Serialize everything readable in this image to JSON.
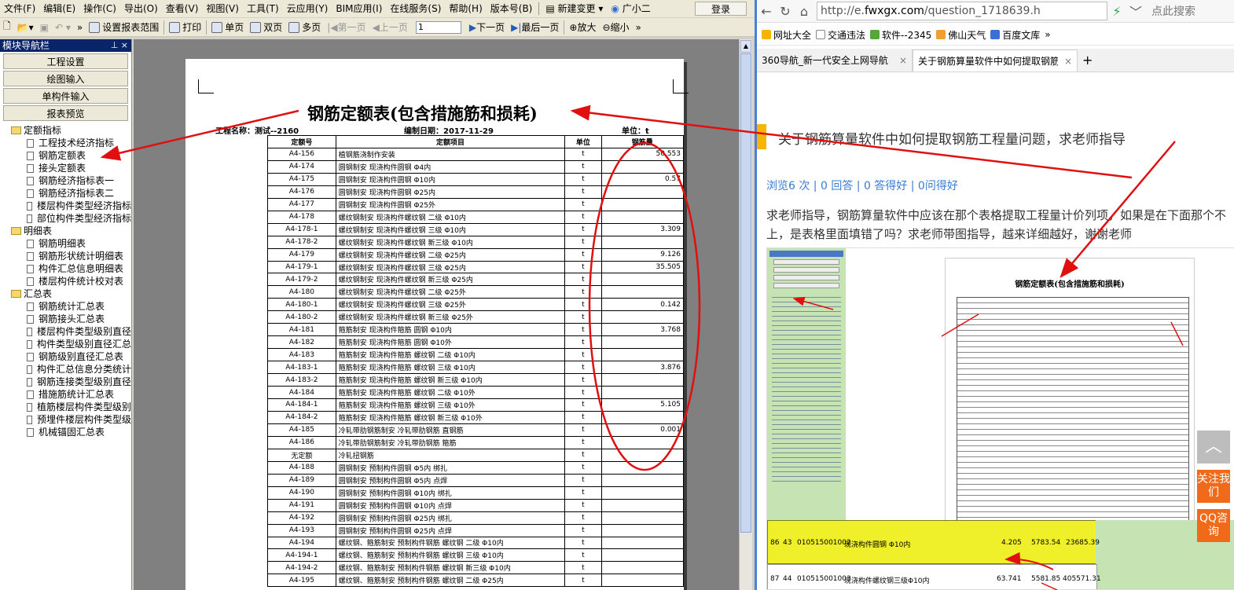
{
  "menubar": {
    "items": [
      "文件(F)",
      "编辑(E)",
      "操作(C)",
      "导出(O)",
      "查看(V)",
      "视图(V)",
      "工具(T)",
      "云应用(Y)",
      "BIM应用(I)",
      "在线服务(S)",
      "帮助(H)",
      "版本号(B)"
    ],
    "new_change": "新建变更",
    "helper": "广小二",
    "login": "登录"
  },
  "toolbar": {
    "set_range": "设置报表范围",
    "print": "打印",
    "single": "单页",
    "double": "双页",
    "multi": "多页",
    "first": "第一页",
    "prev": "上一页",
    "page": "1",
    "next": "下一页",
    "last": "最后一页",
    "zoom_in": "放大",
    "zoom_out": "缩小"
  },
  "nav": {
    "title": "模块导航栏",
    "buttons": [
      "工程设置",
      "绘图输入",
      "单构件输入",
      "报表预览"
    ],
    "tree": [
      {
        "folder": "定额指标",
        "items": [
          "工程技术经济指标",
          "钢筋定额表",
          "接头定额表",
          "钢筋经济指标表一",
          "钢筋经济指标表二",
          "楼层构件类型经济指标",
          "部位构件类型经济指标"
        ]
      },
      {
        "folder": "明细表",
        "items": [
          "钢筋明细表",
          "钢筋形状统计明细表",
          "构件汇总信息明细表",
          "楼层构件统计校对表"
        ]
      },
      {
        "folder": "汇总表",
        "items": [
          "钢筋统计汇总表",
          "钢筋接头汇总表",
          "楼层构件类型级别直径",
          "构件类型级别直径汇总",
          "钢筋级别直径汇总表",
          "构件汇总信息分类统计",
          "钢筋连接类型级别直径",
          "措施筋统计汇总表",
          "植筋楼层构件类型级别",
          "预埋件楼层构件类型级",
          "机械锚固汇总表"
        ]
      }
    ]
  },
  "report": {
    "title": "钢筋定额表(包含措施筋和损耗)",
    "project_label": "工程名称：",
    "project": "测试--2160",
    "date_label": "编制日期：",
    "date": "2017-11-29",
    "unit_label": "单位：",
    "unit": "t",
    "headers": [
      "定额号",
      "定额项目",
      "单位",
      "钢筋量"
    ],
    "rows": [
      [
        "A4-156",
        "植钢筋浇制作安装",
        "t",
        "50.553"
      ],
      [
        "A4-174",
        "圆钢制安 现浇构件圆钢 Φ4内",
        "t",
        ""
      ],
      [
        "A4-175",
        "圆钢制安 现浇构件圆钢 Φ10内",
        "t",
        "0.57"
      ],
      [
        "A4-176",
        "圆钢制安 现浇构件圆钢 Φ25内",
        "t",
        ""
      ],
      [
        "A4-177",
        "圆钢制安 现浇构件圆钢 Φ25外",
        "t",
        ""
      ],
      [
        "A4-178",
        "螺纹钢制安 现浇构件螺纹钢 二级 Φ10内",
        "t",
        ""
      ],
      [
        "A4-178-1",
        "螺纹钢制安 现浇构件螺纹钢 三级 Φ10内",
        "t",
        "3.309"
      ],
      [
        "A4-178-2",
        "螺纹钢制安 现浇构件螺纹钢 新三级 Φ10内",
        "t",
        ""
      ],
      [
        "A4-179",
        "螺纹钢制安 现浇构件螺纹钢 二级 Φ25内",
        "t",
        "9.126"
      ],
      [
        "A4-179-1",
        "螺纹钢制安 现浇构件螺纹钢 三级 Φ25内",
        "t",
        "35.505"
      ],
      [
        "A4-179-2",
        "螺纹钢制安 现浇构件螺纹钢 新三级 Φ25内",
        "t",
        ""
      ],
      [
        "A4-180",
        "螺纹钢制安 现浇构件螺纹钢 二级 Φ25外",
        "t",
        ""
      ],
      [
        "A4-180-1",
        "螺纹钢制安 现浇构件螺纹钢 三级 Φ25外",
        "t",
        "0.142"
      ],
      [
        "A4-180-2",
        "螺纹钢制安 现浇构件螺纹钢 新三级 Φ25外",
        "t",
        ""
      ],
      [
        "A4-181",
        "箍筋制安 现浇构件箍筋 圆钢 Φ10内",
        "t",
        "3.768"
      ],
      [
        "A4-182",
        "箍筋制安 现浇构件箍筋 圆钢 Φ10外",
        "t",
        ""
      ],
      [
        "A4-183",
        "箍筋制安 现浇构件箍筋 螺纹钢 二级 Φ10内",
        "t",
        ""
      ],
      [
        "A4-183-1",
        "箍筋制安 现浇构件箍筋 螺纹钢 三级 Φ10内",
        "t",
        "3.876"
      ],
      [
        "A4-183-2",
        "箍筋制安 现浇构件箍筋 螺纹钢 新三级 Φ10内",
        "t",
        ""
      ],
      [
        "A4-184",
        "箍筋制安 现浇构件箍筋 螺纹钢 二级 Φ10外",
        "t",
        ""
      ],
      [
        "A4-184-1",
        "箍筋制安 现浇构件箍筋 螺纹钢 三级 Φ10外",
        "t",
        "5.105"
      ],
      [
        "A4-184-2",
        "箍筋制安 现浇构件箍筋 螺纹钢 新三级 Φ10外",
        "t",
        ""
      ],
      [
        "A4-185",
        "冷轧带肋钢筋制安 冷轧带肋钢筋 直钢筋",
        "t",
        "0.001"
      ],
      [
        "A4-186",
        "冷轧带肋钢筋制安 冷轧带肋钢筋 箍筋",
        "t",
        ""
      ],
      [
        "无定额",
        "冷轧扭钢筋",
        "t",
        ""
      ],
      [
        "A4-188",
        "圆钢制安 预制构件圆钢 Φ5内 绑扎",
        "t",
        ""
      ],
      [
        "A4-189",
        "圆钢制安 预制构件圆钢 Φ5内 点焊",
        "t",
        ""
      ],
      [
        "A4-190",
        "圆钢制安 预制构件圆钢 Φ10内 绑扎",
        "t",
        ""
      ],
      [
        "A4-191",
        "圆钢制安 预制构件圆钢 Φ10内 点焊",
        "t",
        ""
      ],
      [
        "A4-192",
        "圆钢制安 预制构件圆钢 Φ25内 绑扎",
        "t",
        ""
      ],
      [
        "A4-193",
        "圆钢制安 预制构件圆钢 Φ25内 点焊",
        "t",
        ""
      ],
      [
        "A4-194",
        "螺纹钢、箍筋制安 预制构件钢筋 螺纹钢 二级 Φ10内",
        "t",
        ""
      ],
      [
        "A4-194-1",
        "螺纹钢、箍筋制安 预制构件钢筋 螺纹钢 三级 Φ10内",
        "t",
        ""
      ],
      [
        "A4-194-2",
        "螺纹钢、箍筋制安 预制构件钢筋 螺纹钢 新三级 Φ10内",
        "t",
        ""
      ],
      [
        "A4-195",
        "螺纹钢、箍筋制安 预制构件钢筋 螺纹钢 二级 Φ25内",
        "t",
        ""
      ]
    ]
  },
  "browser": {
    "url_prefix": "http://e.",
    "url_domain": "fwxgx.com",
    "url_rest": "/question_1718639.h",
    "search_placeholder": "点此搜索",
    "bookmarks": [
      "网址大全",
      "交通违法",
      "软件--2345",
      "佛山天气",
      "百度文库"
    ],
    "tabs": [
      {
        "label": "360导航_新一代安全上网导航"
      },
      {
        "label": "关于钢筋算量软件中如何提取钢筋"
      }
    ],
    "question_title": "关于钢筋算量软件中如何提取钢筋工程量问题，求老师指导",
    "stats": "浏览6 次 | 0 回答 | 0 答得好 | 0问得好",
    "body": "求老师指导，钢筋算量软件中应该在那个表格提取工程量计价列项，如果是在下面那个不上，是表格里面填错了吗？求老师带图指导，越来详细越好，谢谢老师",
    "embed_title": "钢筋定额表(包含措施筋和损耗)",
    "embed_row_no_a": "86",
    "embed_row_no_b": "87",
    "embed_idx_a": "43",
    "embed_idx_b": "44",
    "embed_code_a": "010515001002",
    "embed_code_b": "010515001003",
    "embed_name_a": "现浇构件圆钢 Φ10内",
    "embed_name_b": "现浇构件螺纹钢三级Φ10内",
    "embed_qty_a": "4.205",
    "embed_qty_b": "63.741",
    "embed_price_a": "5783.54",
    "embed_price_b": "5581.85",
    "embed_total_a": "23685.39",
    "embed_total_b": "405571.31",
    "side_top": "︿",
    "side_follow": "关注我们",
    "side_qq": "QQ咨询"
  },
  "colors": {
    "nav_title": "#0a246a",
    "annotation": "#e01010",
    "highlight_row": "#f0f02a",
    "side_btn": "#f06a19"
  }
}
